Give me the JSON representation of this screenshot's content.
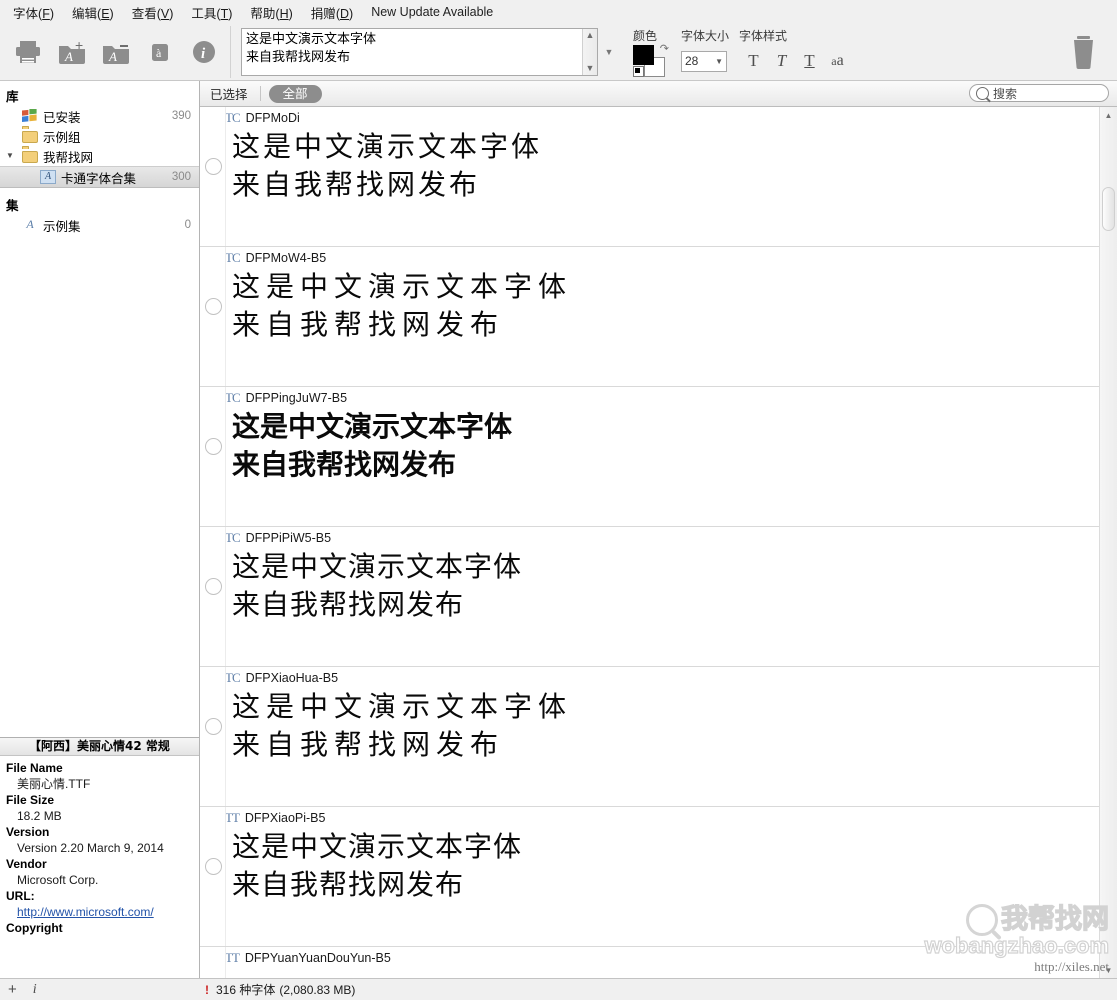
{
  "menubar": {
    "items": [
      {
        "label": "字体",
        "mnemonic": "F"
      },
      {
        "label": "编辑",
        "mnemonic": "E"
      },
      {
        "label": "查看",
        "mnemonic": "V"
      },
      {
        "label": "工具",
        "mnemonic": "T"
      },
      {
        "label": "帮助",
        "mnemonic": "H"
      },
      {
        "label": "捐赠",
        "mnemonic": "D"
      }
    ],
    "update_note": "New Update Available"
  },
  "toolbar": {
    "buttons": [
      {
        "name": "print-button",
        "icon": "printer-icon"
      },
      {
        "name": "add-folder-button",
        "icon": "folder-add-icon"
      },
      {
        "name": "remove-folder-button",
        "icon": "folder-remove-icon"
      },
      {
        "name": "font-button",
        "icon": "font-a-icon"
      },
      {
        "name": "info-button",
        "icon": "info-icon"
      }
    ],
    "sample_text": "这是中文演示文本字体\n来自我帮找网发布",
    "color_label": "颜色",
    "size_label": "字体大小",
    "style_label": "字体样式",
    "font_size": "28",
    "style_buttons": [
      {
        "name": "bold-button",
        "glyph": "T"
      },
      {
        "name": "italic-button",
        "glyph": "T"
      },
      {
        "name": "underline-button",
        "glyph": "T"
      },
      {
        "name": "case-button",
        "glyph": "a"
      }
    ],
    "foreground_color": "#000000",
    "background_color": "#ffffff",
    "trash_tooltip": "删除"
  },
  "sidebar": {
    "library_heading": "库",
    "library_items": [
      {
        "label": "已安装",
        "count": "390",
        "icon": "windows-icon",
        "indent": 1,
        "selected": false
      },
      {
        "label": "示例组",
        "count": "",
        "icon": "folder-icon",
        "indent": 1,
        "selected": false
      },
      {
        "label": "我帮找网",
        "count": "",
        "icon": "folder-icon",
        "indent": 1,
        "selected": false,
        "twisty": "▼"
      },
      {
        "label": "卡通字体合集",
        "count": "300",
        "icon": "font-a-icon",
        "indent": 2,
        "selected": true
      }
    ],
    "sets_heading": "集",
    "sets_items": [
      {
        "label": "示例集",
        "count": "0",
        "icon": "font-a-plain-icon",
        "indent": 1,
        "selected": false
      }
    ]
  },
  "info_panel": {
    "title": "【阿西】美丽心情42 常规",
    "fields": [
      {
        "key": "File Name",
        "value": "美丽心情.TTF",
        "link": false
      },
      {
        "key": "File Size",
        "value": "18.2 MB",
        "link": false
      },
      {
        "key": "Version",
        "value": "Version 2.20 March 9, 2014",
        "link": false
      },
      {
        "key": "Vendor",
        "value": "Microsoft Corp.",
        "link": false
      },
      {
        "key": "URL:",
        "value": "http://www.microsoft.com/",
        "link": true
      },
      {
        "key": "Copyright",
        "value": "",
        "link": false
      }
    ]
  },
  "list_bar": {
    "tab_selected": "已选择",
    "tab_all": "全部",
    "search_placeholder": "搜索"
  },
  "font_list": {
    "preview_text": "这是中文演示文本字体\n来自我帮找网发布",
    "rows": [
      {
        "name": "DFPMoDi",
        "type_icon": "TC",
        "style": "thin"
      },
      {
        "name": "DFPMoW4-B5",
        "type_icon": "TC",
        "style": "wide"
      },
      {
        "name": "DFPPingJuW7-B5",
        "type_icon": "TC",
        "style": "heavy"
      },
      {
        "name": "DFPPiPiW5-B5",
        "type_icon": "TC",
        "style": "semi"
      },
      {
        "name": "DFPXiaoHua-B5",
        "type_icon": "TC",
        "style": "wide"
      },
      {
        "name": "DFPXiaoPi-B5",
        "type_icon": "TT",
        "style": "semi"
      },
      {
        "name": "DFPYuanYuanDouYun-B5",
        "type_icon": "TT",
        "style": "semi"
      }
    ]
  },
  "statusbar": {
    "add_icon": "+",
    "info_icon": "i",
    "warning_icon": "!",
    "count_text": "316 种字体",
    "size_text": "(2,080.83 MB)"
  },
  "watermark": {
    "cn_text": "我帮找网",
    "en_text": "wobangzhao.com",
    "url_text": "http://xiles.net"
  }
}
